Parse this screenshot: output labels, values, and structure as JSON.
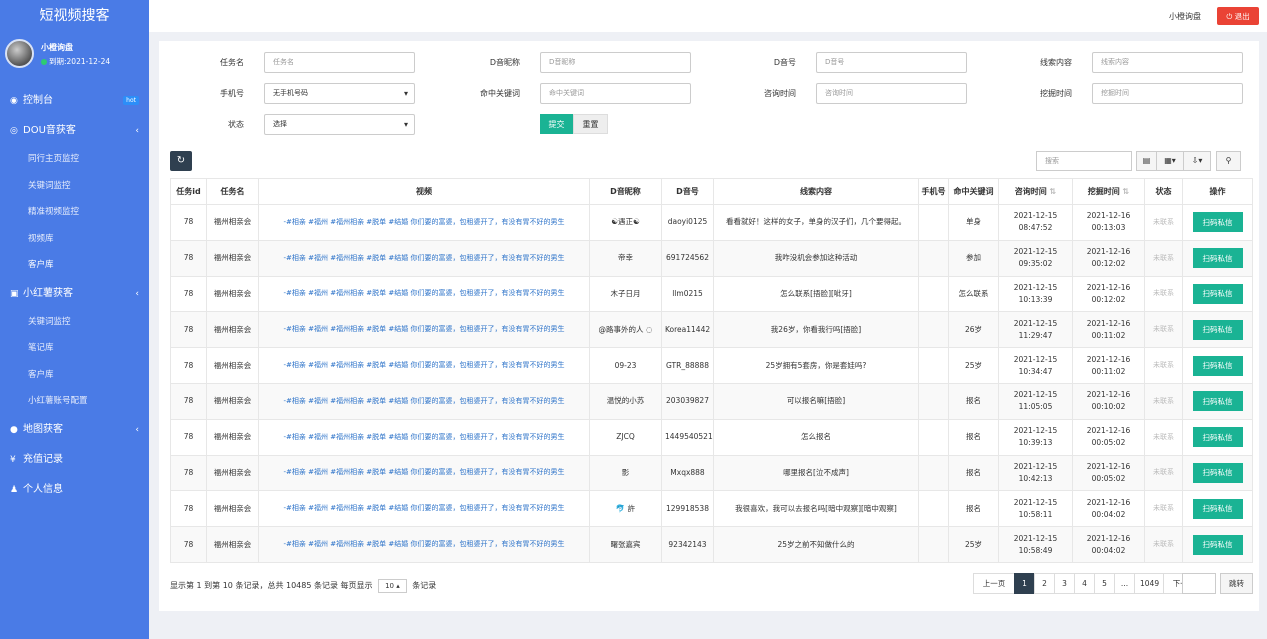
{
  "app": {
    "title": "短视频搜客"
  },
  "user": {
    "name": "小橙询盘",
    "expire": "到期:2021-12-24"
  },
  "sidebar": {
    "dashboard": {
      "label": "控制台",
      "badge": "hot"
    },
    "dou": {
      "label": "DOU音获客",
      "subs": [
        "同行主页监控",
        "关键词监控",
        "精准视频监控",
        "视频库",
        "客户库"
      ]
    },
    "xhs": {
      "label": "小红薯获客",
      "subs": [
        "关键词监控",
        "笔记库",
        "客户库",
        "小红薯账号配置"
      ]
    },
    "map": {
      "label": "地图获客"
    },
    "recharge": {
      "label": "充值记录"
    },
    "profile": {
      "label": "个人信息"
    }
  },
  "topbar": {
    "user": "小橙询盘",
    "logout": "退出"
  },
  "filters": {
    "task": {
      "label": "任务名",
      "placeholder": "任务名"
    },
    "dnick": {
      "label": "D音昵称",
      "placeholder": "D音昵称"
    },
    "dnum": {
      "label": "D音号",
      "placeholder": "D音号"
    },
    "clue": {
      "label": "线索内容",
      "placeholder": "线索内容"
    },
    "phone": {
      "label": "手机号",
      "value": "无手机号码"
    },
    "keyword": {
      "label": "命中关键词",
      "placeholder": "命中关键词"
    },
    "ctime": {
      "label": "咨询时间",
      "placeholder": "咨询时间"
    },
    "mtime": {
      "label": "挖掘时间",
      "placeholder": "挖掘时间"
    },
    "status": {
      "label": "状态",
      "value": "选择"
    },
    "submit": "提交",
    "reset": "重置"
  },
  "toolbar": {
    "search_placeholder": "搜索"
  },
  "table": {
    "headers": [
      "任务id",
      "任务名",
      "视频",
      "D音昵称",
      "D音号",
      "线索内容",
      "手机号",
      "命中关键词",
      "咨询时间",
      "挖掘时间",
      "状态",
      "操作"
    ],
    "rows": [
      {
        "id": "78",
        "task": "福州相亲会",
        "video": "-#相亲 #福州 #福州相亲 #脱单 #结婚 你们要的富婆，包租婆开了，有没有胃不好的男生",
        "nick": "☯遇正☯",
        "dnum": "daoyi0125",
        "clue": "看看就好！这样的女子，单身的汉子们，几个要得起。",
        "phone": "",
        "kw": "单身",
        "ct": "2021-12-15 08:47:52",
        "mt": "2021-12-16 00:13:03",
        "status": "未联系",
        "op": "扫码私信"
      },
      {
        "id": "78",
        "task": "福州相亲会",
        "video": "-#相亲 #福州 #福州相亲 #脱单 #结婚 你们要的富婆，包租婆开了，有没有胃不好的男生",
        "nick": "帝幸",
        "dnum": "691724562",
        "clue": "我咋没机会参加这种活动",
        "phone": "",
        "kw": "参加",
        "ct": "2021-12-15 09:35:02",
        "mt": "2021-12-16 00:12:02",
        "status": "未联系",
        "op": "扫码私信"
      },
      {
        "id": "78",
        "task": "福州相亲会",
        "video": "-#相亲 #福州 #福州相亲 #脱单 #结婚 你们要的富婆，包租婆开了，有没有胃不好的男生",
        "nick": "木子日月",
        "dnum": "llm0215",
        "clue": "怎么联系[捂脸][呲牙]",
        "phone": "",
        "kw": "怎么联系",
        "ct": "2021-12-15 10:13:39",
        "mt": "2021-12-16 00:12:02",
        "status": "未联系",
        "op": "扫码私信"
      },
      {
        "id": "78",
        "task": "福州相亲会",
        "video": "-#相亲 #福州 #福州相亲 #脱单 #结婚 你们要的富婆，包租婆开了，有没有胃不好的男生",
        "nick": "@路事外的人 ◌",
        "dnum": "Korea11442",
        "clue": "我26岁，你看我行吗[捂脸]",
        "phone": "",
        "kw": "26岁",
        "ct": "2021-12-15 11:29:47",
        "mt": "2021-12-16 00:11:02",
        "status": "未联系",
        "op": "扫码私信"
      },
      {
        "id": "78",
        "task": "福州相亲会",
        "video": "-#相亲 #福州 #福州相亲 #脱单 #结婚 你们要的富婆，包租婆开了，有没有胃不好的男生",
        "nick": "09-23",
        "dnum": "GTR_88888",
        "clue": "25岁拥有5套房，你是套娃吗?",
        "phone": "",
        "kw": "25岁",
        "ct": "2021-12-15 10:34:47",
        "mt": "2021-12-16 00:11:02",
        "status": "未联系",
        "op": "扫码私信"
      },
      {
        "id": "78",
        "task": "福州相亲会",
        "video": "-#相亲 #福州 #福州相亲 #脱单 #结婚 你们要的富婆，包租婆开了，有没有胃不好的男生",
        "nick": "温悦的小苏",
        "dnum": "203039827",
        "clue": "可以报名嘛[捂脸]",
        "phone": "",
        "kw": "报名",
        "ct": "2021-12-15 11:05:05",
        "mt": "2021-12-16 00:10:02",
        "status": "未联系",
        "op": "扫码私信"
      },
      {
        "id": "78",
        "task": "福州相亲会",
        "video": "-#相亲 #福州 #福州相亲 #脱单 #结婚 你们要的富婆，包租婆开了，有没有胃不好的男生",
        "nick": "ZJCQ",
        "dnum": "1449540521",
        "clue": "怎么报名",
        "phone": "",
        "kw": "报名",
        "ct": "2021-12-15 10:39:13",
        "mt": "2021-12-16 00:05:02",
        "status": "未联系",
        "op": "扫码私信"
      },
      {
        "id": "78",
        "task": "福州相亲会",
        "video": "-#相亲 #福州 #福州相亲 #脱单 #结婚 你们要的富婆，包租婆开了，有没有胃不好的男生",
        "nick": "影",
        "dnum": "Mxqx888",
        "clue": "哪里报名[泣不成声]",
        "phone": "",
        "kw": "报名",
        "ct": "2021-12-15 10:42:13",
        "mt": "2021-12-16 00:05:02",
        "status": "未联系",
        "op": "扫码私信"
      },
      {
        "id": "78",
        "task": "福州相亲会",
        "video": "-#相亲 #福州 #福州相亲 #脱单 #结婚 你们要的富婆，包租婆开了，有没有胃不好的男生",
        "nick": "🐬 許",
        "dnum": "129918538",
        "clue": "我很喜欢，我可以去报名吗[暗中观察][暗中观察]",
        "phone": "",
        "kw": "报名",
        "ct": "2021-12-15 10:58:11",
        "mt": "2021-12-16 00:04:02",
        "status": "未联系",
        "op": "扫码私信"
      },
      {
        "id": "78",
        "task": "福州相亲会",
        "video": "-#相亲 #福州 #福州相亲 #脱单 #结婚 你们要的富婆，包租婆开了，有没有胃不好的男生",
        "nick": "曙张嘉宾",
        "dnum": "92342143",
        "clue": "25岁之前不知做什么的",
        "phone": "",
        "kw": "25岁",
        "ct": "2021-12-15 10:58:49",
        "mt": "2021-12-16 00:04:02",
        "status": "未联系",
        "op": "扫码私信"
      }
    ]
  },
  "footer": {
    "info_prefix": "显示第 1 到第 10 条记录，总共 10485 条记录 每页显示",
    "page_size": "10",
    "info_suffix": "条记录"
  },
  "pagination": {
    "prev": "上一页",
    "pages": [
      "1",
      "2",
      "3",
      "4",
      "5",
      "...",
      "1049"
    ],
    "next": "下一页",
    "jump": "跳转"
  }
}
